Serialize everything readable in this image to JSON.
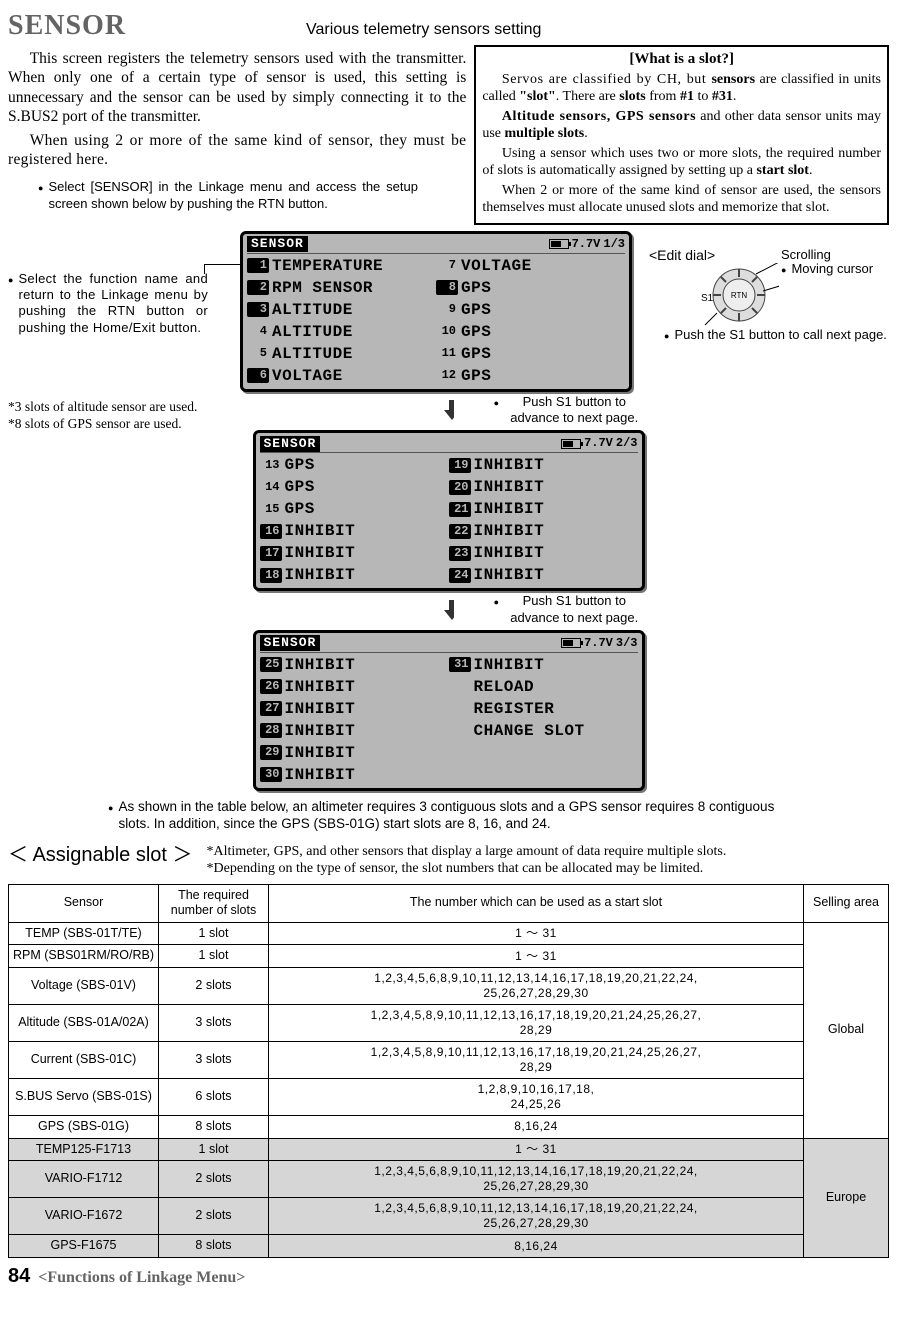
{
  "header": {
    "title": "SENSOR",
    "subtitle": "Various telemetry sensors setting"
  },
  "intro": {
    "p1": "This screen registers the telemetry sensors used with the transmitter. When only one of a certain type of sensor is used, this setting is unnecessary and the sensor can be used by simply connecting it to the S.BUS2 port of the transmitter.",
    "p2": "When using 2 or more of the same kind of sensor, they must be registered here.",
    "step_select": "Select [SENSOR] in the Linkage menu and access the setup screen shown below by pushing the RTN button."
  },
  "slot_box": {
    "title": "[What is a slot?]",
    "p1a": "Servos are classified by CH, but ",
    "p1b": "sensors",
    "p1c": " are classified in units called ",
    "p1d": "\"slot\"",
    "p1e": ". There are ",
    "p1f": "slots",
    "p1g": " from ",
    "p1h": "#1",
    "p1i": " to ",
    "p1j": "#31",
    "p1k": ".",
    "p2a": "Altitude sensors, GPS sensors",
    "p2b": " and other data sensor units may use ",
    "p2c": "multiple slots",
    "p2d": ".",
    "p3a": "Using a sensor which uses two or more slots, the required number of slots is automatically assigned by setting up a ",
    "p3b": "start slot",
    "p3c": ".",
    "p4": "When 2 or more of the same kind of sensor are used, the sensors themselves must allocate unused slots and memorize that slot."
  },
  "annot": {
    "left": "Select the function name and return to the Linkage menu by pushing the RTN button or pushing the Home/Exit button.",
    "footn1": "*3 slots of altitude sensor are used.",
    "footn2": "*8 slots of GPS sensor are used.",
    "push_s1_a": "Push S1 button to advance to next page.",
    "push_s1_b": "Push S1 button to advance to next page.",
    "edit_dial": "<Edit dial>",
    "scrolling": "Scrolling",
    "moving": "Moving cursor",
    "push_s1_dial": "Push the S1 button to call next page.",
    "s1_label": "S1",
    "rtn_label": "RTN"
  },
  "screens": {
    "common": {
      "title": "SENSOR",
      "batt": "7.7V"
    },
    "page1": {
      "pager": "1/3",
      "left": [
        {
          "n": "1",
          "inv": true,
          "lbl": "TEMPERATURE"
        },
        {
          "n": "2",
          "inv": true,
          "lbl": "RPM SENSOR"
        },
        {
          "n": "3",
          "inv": true,
          "lbl": "ALTITUDE"
        },
        {
          "n": "4",
          "inv": false,
          "lbl": "ALTITUDE"
        },
        {
          "n": "5",
          "inv": false,
          "lbl": "ALTITUDE"
        },
        {
          "n": "6",
          "inv": true,
          "lbl": "VOLTAGE"
        }
      ],
      "right": [
        {
          "n": "7",
          "inv": false,
          "lbl": "VOLTAGE"
        },
        {
          "n": "8",
          "inv": true,
          "lbl": "GPS"
        },
        {
          "n": "9",
          "inv": false,
          "lbl": "GPS"
        },
        {
          "n": "10",
          "inv": false,
          "lbl": "GPS"
        },
        {
          "n": "11",
          "inv": false,
          "lbl": "GPS"
        },
        {
          "n": "12",
          "inv": false,
          "lbl": "GPS"
        }
      ]
    },
    "page2": {
      "pager": "2/3",
      "left": [
        {
          "n": "13",
          "inv": false,
          "lbl": "GPS"
        },
        {
          "n": "14",
          "inv": false,
          "lbl": "GPS"
        },
        {
          "n": "15",
          "inv": false,
          "lbl": "GPS"
        },
        {
          "n": "16",
          "inv": true,
          "lbl": "INHIBIT"
        },
        {
          "n": "17",
          "inv": true,
          "lbl": "INHIBIT"
        },
        {
          "n": "18",
          "inv": true,
          "lbl": "INHIBIT"
        }
      ],
      "right": [
        {
          "n": "19",
          "inv": true,
          "lbl": "INHIBIT"
        },
        {
          "n": "20",
          "inv": true,
          "lbl": "INHIBIT"
        },
        {
          "n": "21",
          "inv": true,
          "lbl": "INHIBIT"
        },
        {
          "n": "22",
          "inv": true,
          "lbl": "INHIBIT"
        },
        {
          "n": "23",
          "inv": true,
          "lbl": "INHIBIT"
        },
        {
          "n": "24",
          "inv": true,
          "lbl": "INHIBIT"
        }
      ]
    },
    "page3": {
      "pager": "3/3",
      "left": [
        {
          "n": "25",
          "inv": true,
          "lbl": "INHIBIT"
        },
        {
          "n": "26",
          "inv": true,
          "lbl": "INHIBIT"
        },
        {
          "n": "27",
          "inv": true,
          "lbl": "INHIBIT"
        },
        {
          "n": "28",
          "inv": true,
          "lbl": "INHIBIT"
        },
        {
          "n": "29",
          "inv": true,
          "lbl": "INHIBIT"
        },
        {
          "n": "30",
          "inv": true,
          "lbl": "INHIBIT"
        }
      ],
      "right": [
        {
          "n": "31",
          "inv": true,
          "lbl": "INHIBIT"
        },
        {
          "n": "",
          "inv": false,
          "lbl": "RELOAD"
        },
        {
          "n": "",
          "inv": false,
          "lbl": "REGISTER"
        },
        {
          "n": "",
          "inv": false,
          "lbl": "CHANGE SLOT"
        }
      ]
    }
  },
  "table_caption": "As shown in the table below, an altimeter requires 3 contiguous slots and a GPS sensor requires 8 contiguous slots. In addition, since the GPS (SBS-01G) start slots are 8, 16, and 24.",
  "assign": {
    "heading": "＜ Assignable slot ＞",
    "note1": "*Altimeter, GPS, and other sensors that display a large amount of data require multiple slots.",
    "note2": "*Depending on the type of sensor, the slot numbers that can be allocated may be limited."
  },
  "table": {
    "headers": {
      "sensor": "Sensor",
      "req": "The required number of slots",
      "start": "The number which can be used as a start slot",
      "area": "Selling area"
    },
    "areas": {
      "global": "Global",
      "europe": "Europe"
    },
    "rows_global": [
      {
        "sensor": "TEMP (SBS-01T/TE)",
        "req": "1 slot",
        "start": "1 ～ 31"
      },
      {
        "sensor": "RPM (SBS01RM/RO/RB)",
        "req": "1 slot",
        "start": "1 ～ 31"
      },
      {
        "sensor": "Voltage (SBS-01V)",
        "req": "2 slots",
        "start": "1,2,3,4,5,6,8,9,10,11,12,13,14,16,17,18,19,20,21,22,24,\n25,26,27,28,29,30"
      },
      {
        "sensor": "Altitude (SBS-01A/02A)",
        "req": "3 slots",
        "start": "1,2,3,4,5,8,9,10,11,12,13,16,17,18,19,20,21,24,25,26,27,\n28,29"
      },
      {
        "sensor": "Current (SBS-01C)",
        "req": "3 slots",
        "start": "1,2,3,4,5,8,9,10,11,12,13,16,17,18,19,20,21,24,25,26,27,\n28,29"
      },
      {
        "sensor": "S.BUS Servo (SBS-01S)",
        "req": "6 slots",
        "start": "1,2,8,9,10,16,17,18,\n24,25,26"
      },
      {
        "sensor": "GPS (SBS-01G)",
        "req": "8 slots",
        "start": "8,16,24"
      }
    ],
    "rows_europe": [
      {
        "sensor": "TEMP125-F1713",
        "req": "1 slot",
        "start": "1 ～ 31"
      },
      {
        "sensor": "VARIO-F1712",
        "req": "2 slots",
        "start": "1,2,3,4,5,6,8,9,10,11,12,13,14,16,17,18,19,20,21,22,24,\n25,26,27,28,29,30"
      },
      {
        "sensor": "VARIO-F1672",
        "req": "2 slots",
        "start": "1,2,3,4,5,6,8,9,10,11,12,13,14,16,17,18,19,20,21,22,24,\n25,26,27,28,29,30"
      },
      {
        "sensor": "GPS-F1675",
        "req": "8 slots",
        "start": "8,16,24"
      }
    ]
  },
  "footer": {
    "page": "84",
    "section": "<Functions of Linkage Menu>"
  }
}
